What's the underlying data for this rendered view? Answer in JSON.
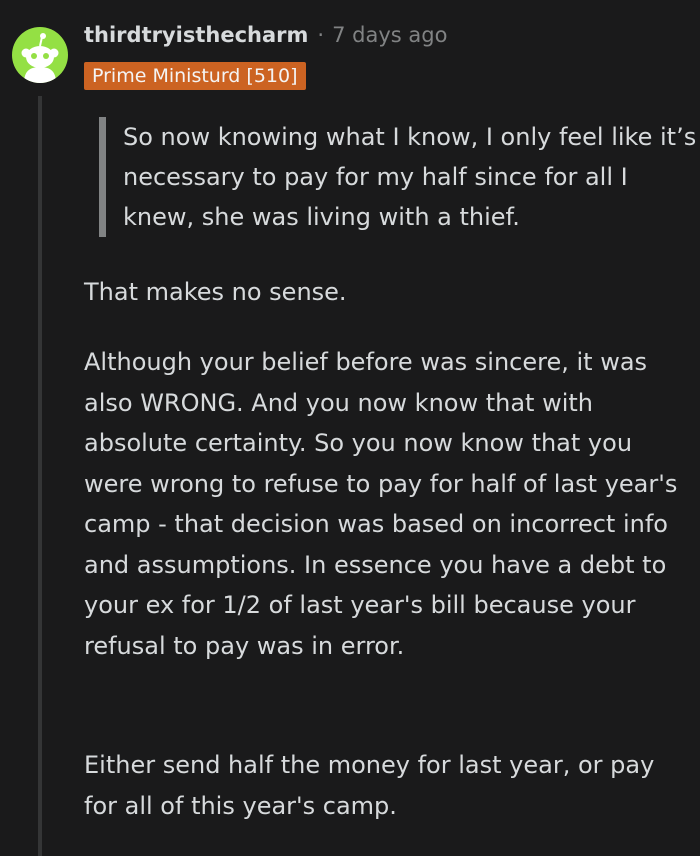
{
  "comment": {
    "username": "thirdtryisthecharm",
    "separator": "·",
    "timestamp": "7 days ago",
    "flair": "Prime Ministurd [510]",
    "quote": "So now knowing what I know, I only feel like it’s necessary to pay for my half since for all I knew, she was living with a thief.",
    "paragraphs": [
      "That makes no sense.",
      "Although your belief before was sincere, it was also WRONG. And you now know that with absolute certainty. So you now know that you were wrong to refuse to pay for half of last year's camp - that decision was based on incorrect info and assumptions. In essence you have a debt to your ex for 1/2 of last year's bill because your refusal to pay was in error.",
      "Either send half the money for last year, or pay for all of this year's camp."
    ]
  },
  "colors": {
    "background": "#1a1a1b",
    "text": "#d7dadc",
    "muted": "#818384",
    "flair_bg": "#cc6322",
    "avatar_bg": "#94e044",
    "thread_line": "#343536"
  },
  "icons": {
    "avatar": "snoo-avatar-icon"
  }
}
